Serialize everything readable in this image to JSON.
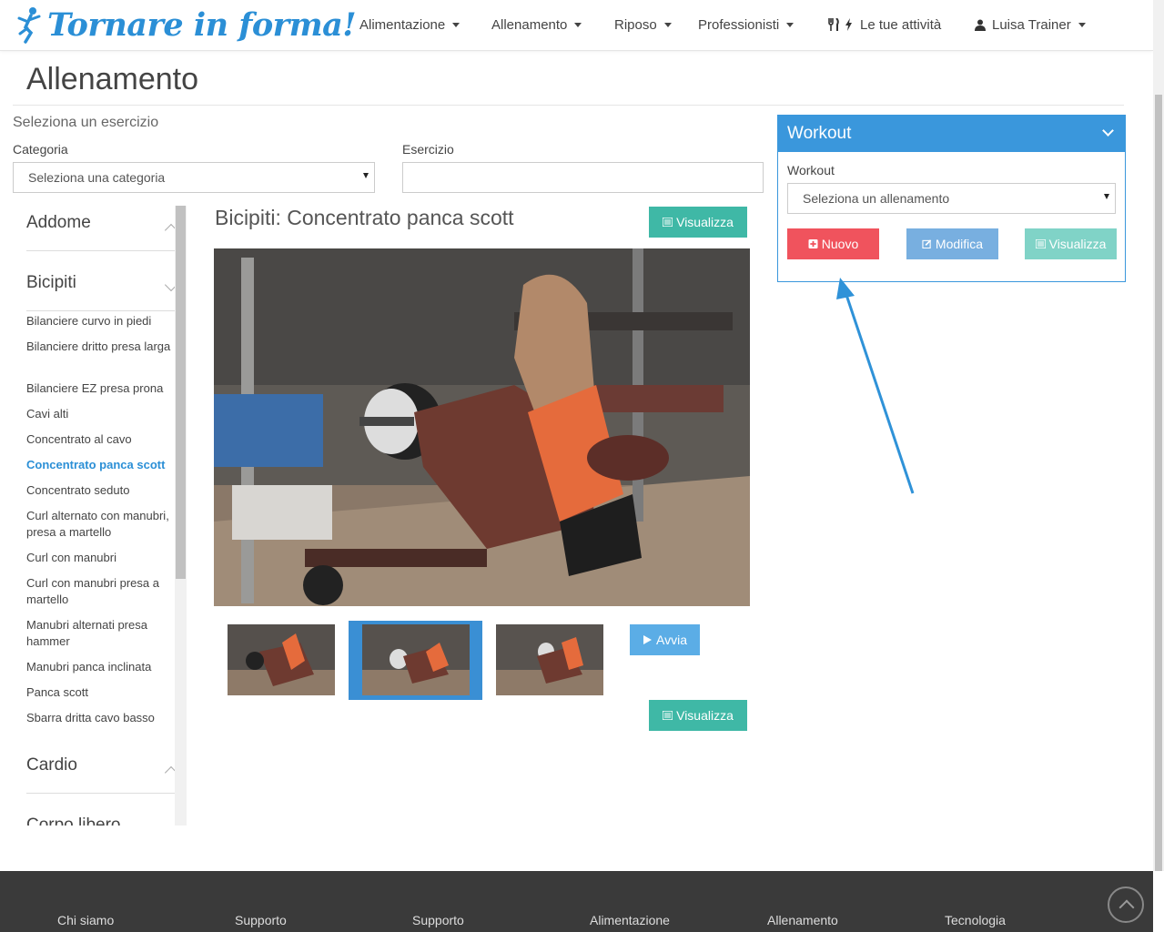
{
  "brand": {
    "name": "Tornare in forma!"
  },
  "nav": {
    "items": [
      {
        "label": "Alimentazione"
      },
      {
        "label": "Allenamento"
      },
      {
        "label": "Riposo"
      },
      {
        "label": "Professionisti"
      },
      {
        "label": "Le tue attività"
      },
      {
        "label": "Luisa Trainer"
      }
    ]
  },
  "page": {
    "title": "Allenamento"
  },
  "filter": {
    "heading": "Seleziona un esercizio",
    "category_label": "Categoria",
    "category_value": "Seleziona una categoria",
    "exercise_label": "Esercizio",
    "exercise_value": ""
  },
  "sidebar": {
    "categories": [
      {
        "label": "Addome",
        "expanded": false
      },
      {
        "label": "Bicipiti",
        "expanded": true
      },
      {
        "label": "Cardio",
        "expanded": false
      },
      {
        "label": "Corpo libero",
        "expanded": false
      }
    ],
    "exercises": [
      "Bilanciere curvo in piedi",
      "Bilanciere dritto presa larga",
      "Bilanciere EZ presa prona",
      "Cavi alti",
      "Concentrato al cavo",
      "Concentrato panca scott",
      "Concentrato seduto",
      "Curl alternato con manubri, presa a martello",
      "Curl con manubri",
      "Curl con manubri presa a martello",
      "Manubri alternati presa hammer",
      "Manubri panca inclinata",
      "Panca scott",
      "Sbarra dritta cavo basso"
    ],
    "active_exercise": "Concentrato panca scott"
  },
  "exercise": {
    "title": "Bicipiti: Concentrato panca scott",
    "view_label": "Visualizza",
    "play_label": "Avvia",
    "view_label_bottom": "Visualizza",
    "selected_thumb": 2
  },
  "workout": {
    "panel_title": "Workout",
    "field_label": "Workout",
    "select_value": "Seleziona un allenamento",
    "new_label": "Nuovo",
    "edit_label": "Modifica",
    "view_label": "Visualizza"
  },
  "colors": {
    "brand_blue": "#2b8fd6",
    "panel_blue": "#3a97dc",
    "teal": "#3fb8a6",
    "red": "#f0535d",
    "light_blue": "#78afe0",
    "light_teal": "#80d3c7",
    "footer": "#3a3a3a"
  },
  "footer": {
    "columns": [
      "Chi siamo",
      "Supporto",
      "Supporto",
      "Alimentazione",
      "Allenamento",
      "Tecnologia"
    ]
  }
}
